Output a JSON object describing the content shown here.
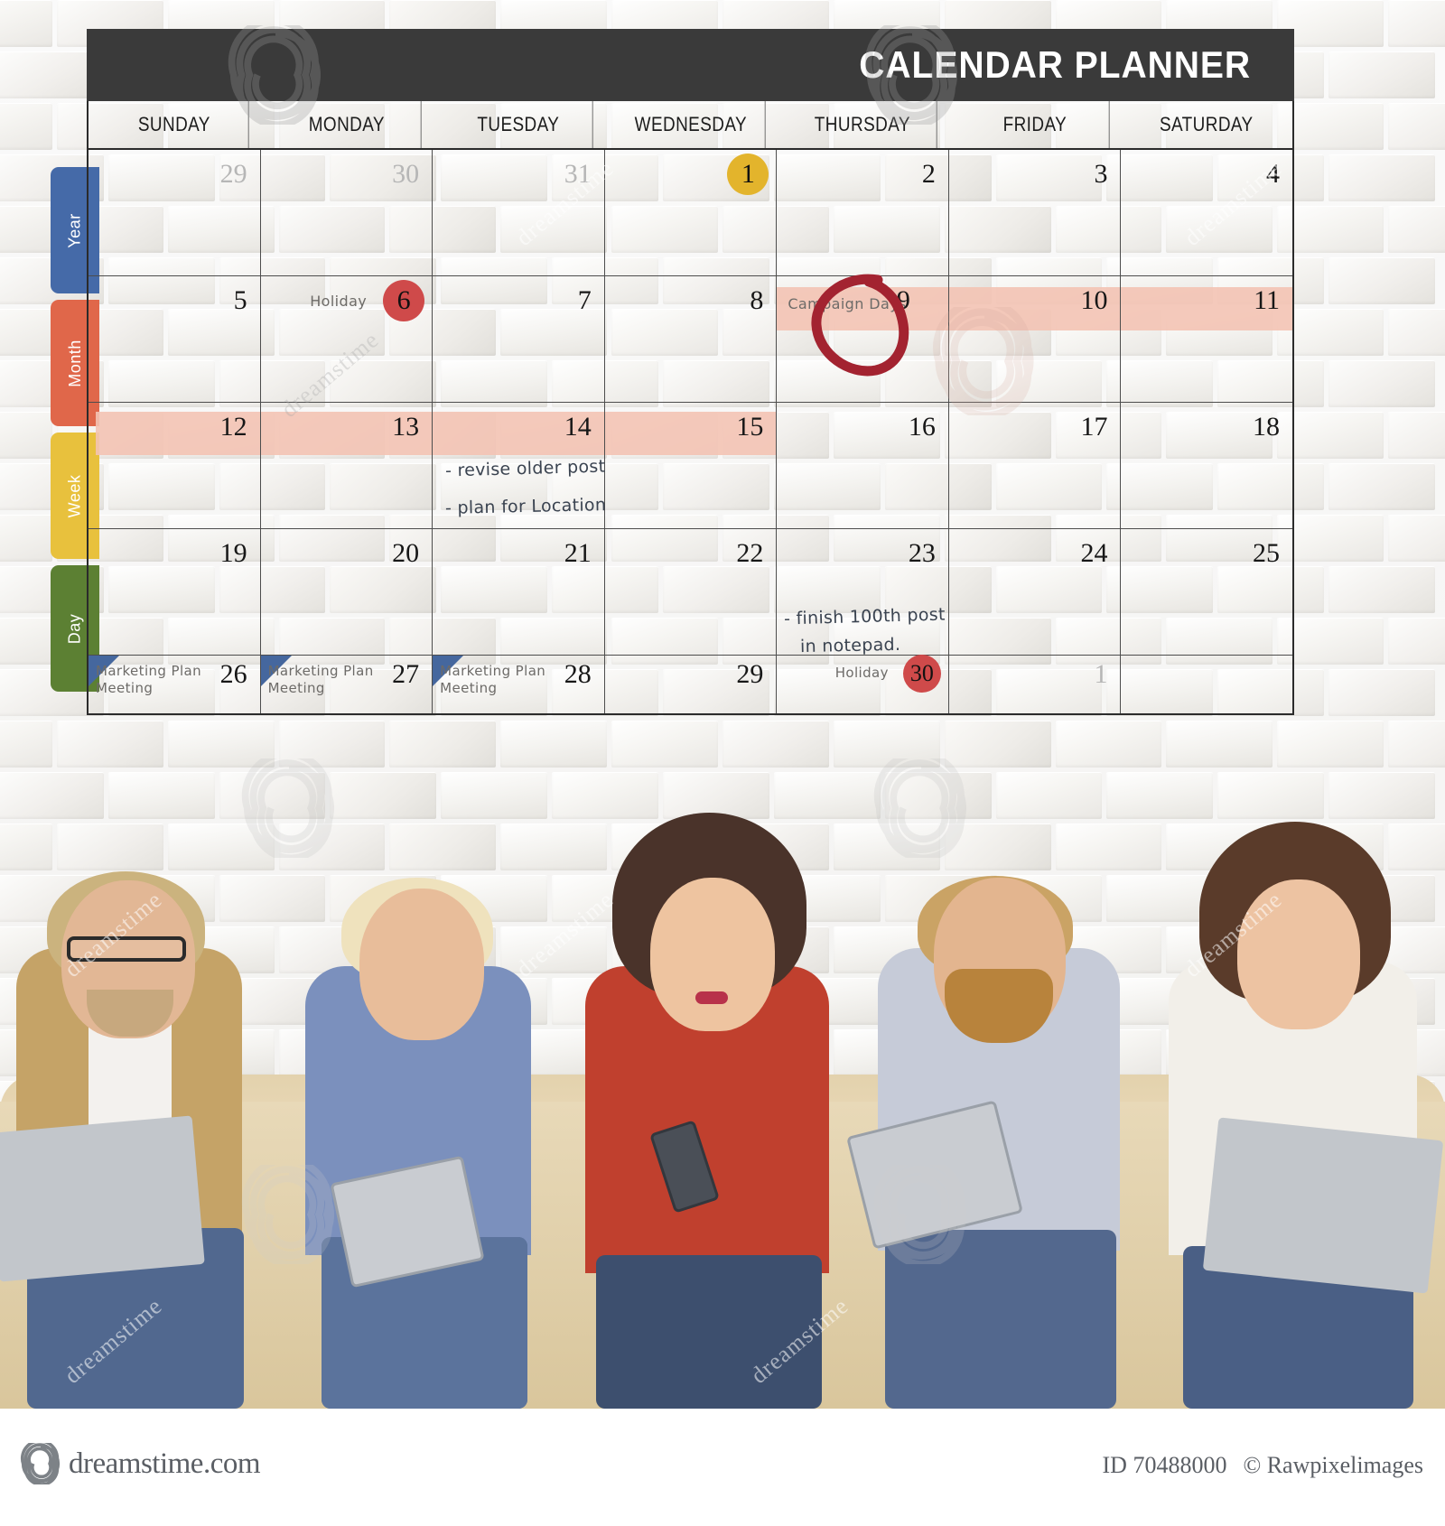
{
  "header": {
    "title": "CALENDAR PLANNER"
  },
  "side_tabs": [
    {
      "label": "Year",
      "color": "#456aa8"
    },
    {
      "label": "Month",
      "color": "#e0674a"
    },
    {
      "label": "Week",
      "color": "#e8c13d"
    },
    {
      "label": "Day",
      "color": "#5c8033"
    }
  ],
  "day_names": [
    "SUNDAY",
    "MONDAY",
    "TUESDAY",
    "WEDNESDAY",
    "THURSDAY",
    "FRIDAY",
    "SATURDAY"
  ],
  "weeks": [
    [
      {
        "num": "29",
        "muted": true
      },
      {
        "num": "30",
        "muted": true
      },
      {
        "num": "31",
        "muted": true
      },
      {
        "num": "1",
        "badge": "yellow"
      },
      {
        "num": "2"
      },
      {
        "num": "3"
      },
      {
        "num": "4"
      }
    ],
    [
      {
        "num": "5"
      },
      {
        "num": "6",
        "badge": "red",
        "event": "Holiday"
      },
      {
        "num": "7"
      },
      {
        "num": "8"
      },
      {
        "num": "9",
        "event": "Campaign Days",
        "circled": true
      },
      {
        "num": "10"
      },
      {
        "num": "11"
      }
    ],
    [
      {
        "num": "12"
      },
      {
        "num": "13"
      },
      {
        "num": "14"
      },
      {
        "num": "15"
      },
      {
        "num": "16"
      },
      {
        "num": "17"
      },
      {
        "num": "18"
      }
    ],
    [
      {
        "num": "19"
      },
      {
        "num": "20"
      },
      {
        "num": "21"
      },
      {
        "num": "22"
      },
      {
        "num": "23"
      },
      {
        "num": "24"
      },
      {
        "num": "25"
      }
    ],
    [
      {
        "num": "26",
        "event": "Marketing Plan\nMeeting",
        "corner": true
      },
      {
        "num": "27",
        "event": "Marketing Plan\nMeeting",
        "corner": true
      },
      {
        "num": "28",
        "event": "Marketing Plan\nMeeting",
        "corner": true
      },
      {
        "num": "29"
      },
      {
        "num": "30",
        "badge": "red",
        "event": "Holiday"
      },
      {
        "num": "1",
        "muted": true
      },
      {
        "num": ""
      }
    ]
  ],
  "notes": [
    {
      "text": "- revise older post"
    },
    {
      "text": "- plan for Location"
    },
    {
      "text": "- finish 100th post"
    },
    {
      "text": "in notepad."
    }
  ],
  "highlights": {
    "campaign_days": "Thursday to Saturday, week of 9",
    "week_of_12": "Sunday to Wednesday, 12 to 15"
  },
  "colors": {
    "header_bar": "#3a3a3a",
    "highlight_pink": "#f3c3b4",
    "circle_red": "#cf4a4a",
    "circle_yellow": "#e3b42c",
    "marker_red": "#a32330",
    "corner_blue": "#45679e"
  },
  "footer": {
    "brand": "dreamstime.com",
    "image_id": "ID 70488000",
    "copyright": "© Rawpixelimages"
  },
  "watermark": {
    "text": "dreamstime"
  }
}
